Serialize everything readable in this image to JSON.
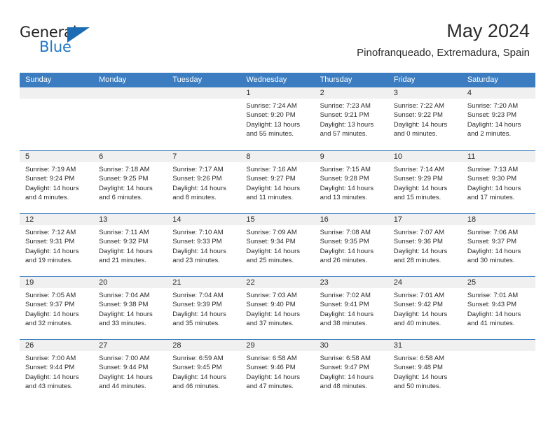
{
  "brand": {
    "name_part1": "General",
    "name_part2": "Blue",
    "logo_icon": "blue-triangle-icon"
  },
  "header": {
    "title": "May 2024",
    "subtitle": "Pinofranqueado, Extremadura, Spain"
  },
  "calendar": {
    "weekday_headers": [
      "Sunday",
      "Monday",
      "Tuesday",
      "Wednesday",
      "Thursday",
      "Friday",
      "Saturday"
    ],
    "accent_color": "#3b7dc0",
    "daynum_band_color": "#f0f0f0",
    "weeks": [
      [
        {
          "date": "",
          "lines": []
        },
        {
          "date": "",
          "lines": []
        },
        {
          "date": "",
          "lines": []
        },
        {
          "date": "1",
          "lines": [
            "Sunrise: 7:24 AM",
            "Sunset: 9:20 PM",
            "Daylight: 13 hours",
            "and 55 minutes."
          ]
        },
        {
          "date": "2",
          "lines": [
            "Sunrise: 7:23 AM",
            "Sunset: 9:21 PM",
            "Daylight: 13 hours",
            "and 57 minutes."
          ]
        },
        {
          "date": "3",
          "lines": [
            "Sunrise: 7:22 AM",
            "Sunset: 9:22 PM",
            "Daylight: 14 hours",
            "and 0 minutes."
          ]
        },
        {
          "date": "4",
          "lines": [
            "Sunrise: 7:20 AM",
            "Sunset: 9:23 PM",
            "Daylight: 14 hours",
            "and 2 minutes."
          ]
        }
      ],
      [
        {
          "date": "5",
          "lines": [
            "Sunrise: 7:19 AM",
            "Sunset: 9:24 PM",
            "Daylight: 14 hours",
            "and 4 minutes."
          ]
        },
        {
          "date": "6",
          "lines": [
            "Sunrise: 7:18 AM",
            "Sunset: 9:25 PM",
            "Daylight: 14 hours",
            "and 6 minutes."
          ]
        },
        {
          "date": "7",
          "lines": [
            "Sunrise: 7:17 AM",
            "Sunset: 9:26 PM",
            "Daylight: 14 hours",
            "and 8 minutes."
          ]
        },
        {
          "date": "8",
          "lines": [
            "Sunrise: 7:16 AM",
            "Sunset: 9:27 PM",
            "Daylight: 14 hours",
            "and 11 minutes."
          ]
        },
        {
          "date": "9",
          "lines": [
            "Sunrise: 7:15 AM",
            "Sunset: 9:28 PM",
            "Daylight: 14 hours",
            "and 13 minutes."
          ]
        },
        {
          "date": "10",
          "lines": [
            "Sunrise: 7:14 AM",
            "Sunset: 9:29 PM",
            "Daylight: 14 hours",
            "and 15 minutes."
          ]
        },
        {
          "date": "11",
          "lines": [
            "Sunrise: 7:13 AM",
            "Sunset: 9:30 PM",
            "Daylight: 14 hours",
            "and 17 minutes."
          ]
        }
      ],
      [
        {
          "date": "12",
          "lines": [
            "Sunrise: 7:12 AM",
            "Sunset: 9:31 PM",
            "Daylight: 14 hours",
            "and 19 minutes."
          ]
        },
        {
          "date": "13",
          "lines": [
            "Sunrise: 7:11 AM",
            "Sunset: 9:32 PM",
            "Daylight: 14 hours",
            "and 21 minutes."
          ]
        },
        {
          "date": "14",
          "lines": [
            "Sunrise: 7:10 AM",
            "Sunset: 9:33 PM",
            "Daylight: 14 hours",
            "and 23 minutes."
          ]
        },
        {
          "date": "15",
          "lines": [
            "Sunrise: 7:09 AM",
            "Sunset: 9:34 PM",
            "Daylight: 14 hours",
            "and 25 minutes."
          ]
        },
        {
          "date": "16",
          "lines": [
            "Sunrise: 7:08 AM",
            "Sunset: 9:35 PM",
            "Daylight: 14 hours",
            "and 26 minutes."
          ]
        },
        {
          "date": "17",
          "lines": [
            "Sunrise: 7:07 AM",
            "Sunset: 9:36 PM",
            "Daylight: 14 hours",
            "and 28 minutes."
          ]
        },
        {
          "date": "18",
          "lines": [
            "Sunrise: 7:06 AM",
            "Sunset: 9:37 PM",
            "Daylight: 14 hours",
            "and 30 minutes."
          ]
        }
      ],
      [
        {
          "date": "19",
          "lines": [
            "Sunrise: 7:05 AM",
            "Sunset: 9:37 PM",
            "Daylight: 14 hours",
            "and 32 minutes."
          ]
        },
        {
          "date": "20",
          "lines": [
            "Sunrise: 7:04 AM",
            "Sunset: 9:38 PM",
            "Daylight: 14 hours",
            "and 33 minutes."
          ]
        },
        {
          "date": "21",
          "lines": [
            "Sunrise: 7:04 AM",
            "Sunset: 9:39 PM",
            "Daylight: 14 hours",
            "and 35 minutes."
          ]
        },
        {
          "date": "22",
          "lines": [
            "Sunrise: 7:03 AM",
            "Sunset: 9:40 PM",
            "Daylight: 14 hours",
            "and 37 minutes."
          ]
        },
        {
          "date": "23",
          "lines": [
            "Sunrise: 7:02 AM",
            "Sunset: 9:41 PM",
            "Daylight: 14 hours",
            "and 38 minutes."
          ]
        },
        {
          "date": "24",
          "lines": [
            "Sunrise: 7:01 AM",
            "Sunset: 9:42 PM",
            "Daylight: 14 hours",
            "and 40 minutes."
          ]
        },
        {
          "date": "25",
          "lines": [
            "Sunrise: 7:01 AM",
            "Sunset: 9:43 PM",
            "Daylight: 14 hours",
            "and 41 minutes."
          ]
        }
      ],
      [
        {
          "date": "26",
          "lines": [
            "Sunrise: 7:00 AM",
            "Sunset: 9:44 PM",
            "Daylight: 14 hours",
            "and 43 minutes."
          ]
        },
        {
          "date": "27",
          "lines": [
            "Sunrise: 7:00 AM",
            "Sunset: 9:44 PM",
            "Daylight: 14 hours",
            "and 44 minutes."
          ]
        },
        {
          "date": "28",
          "lines": [
            "Sunrise: 6:59 AM",
            "Sunset: 9:45 PM",
            "Daylight: 14 hours",
            "and 46 minutes."
          ]
        },
        {
          "date": "29",
          "lines": [
            "Sunrise: 6:58 AM",
            "Sunset: 9:46 PM",
            "Daylight: 14 hours",
            "and 47 minutes."
          ]
        },
        {
          "date": "30",
          "lines": [
            "Sunrise: 6:58 AM",
            "Sunset: 9:47 PM",
            "Daylight: 14 hours",
            "and 48 minutes."
          ]
        },
        {
          "date": "31",
          "lines": [
            "Sunrise: 6:58 AM",
            "Sunset: 9:48 PM",
            "Daylight: 14 hours",
            "and 50 minutes."
          ]
        },
        {
          "date": "",
          "lines": []
        }
      ]
    ]
  }
}
